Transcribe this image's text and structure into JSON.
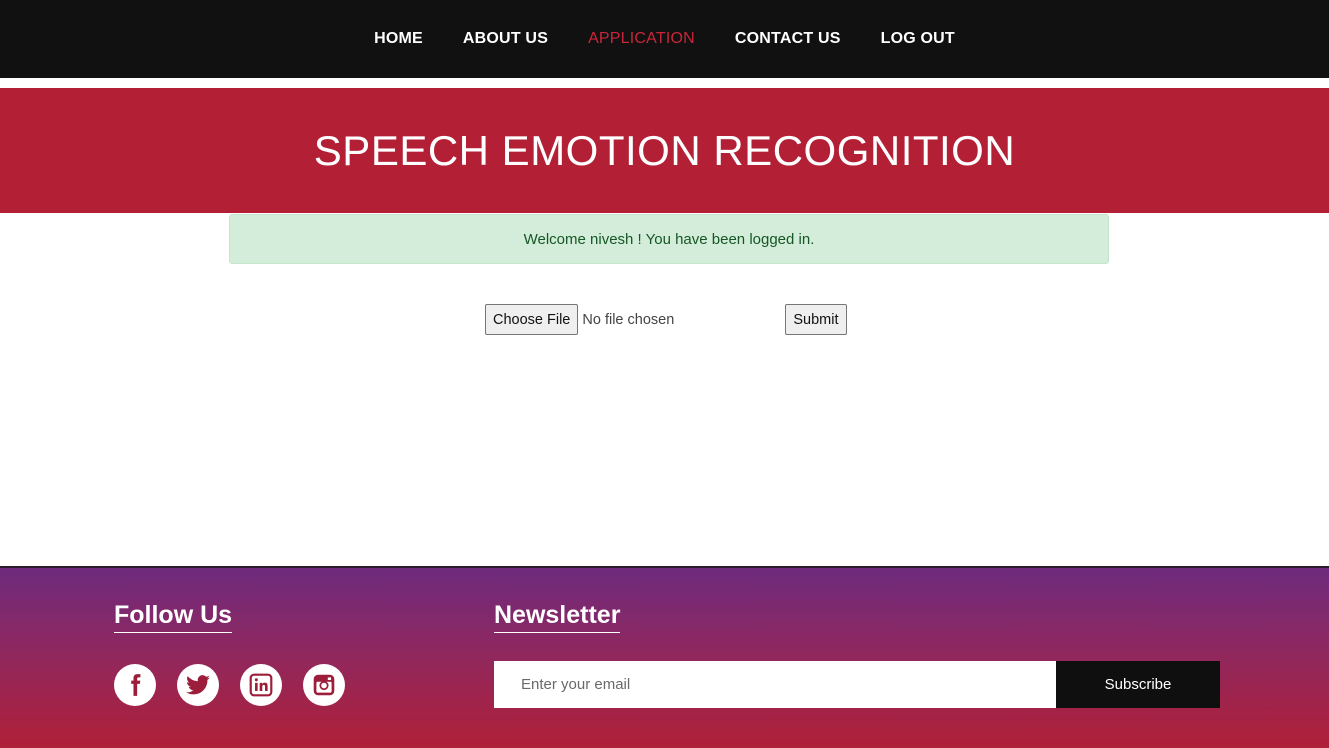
{
  "nav": {
    "items": [
      {
        "label": "HOME",
        "active": false
      },
      {
        "label": "ABOUT US",
        "active": false
      },
      {
        "label": "APPLICATION",
        "active": true
      },
      {
        "label": "CONTACT US",
        "active": false
      },
      {
        "label": "LOG OUT",
        "active": false
      }
    ]
  },
  "hero": {
    "title": "SPEECH EMOTION RECOGNITION"
  },
  "alert": {
    "message": "Welcome nivesh ! You have been logged in."
  },
  "upload": {
    "choose_label": "Choose File",
    "status": "No file chosen",
    "submit_label": "Submit"
  },
  "footer": {
    "follow_title": "Follow Us",
    "socials": [
      "facebook-icon",
      "twitter-icon",
      "linkedin-icon",
      "instagram-icon"
    ],
    "newsletter_title": "Newsletter",
    "email_placeholder": "Enter your email",
    "subscribe_label": "Subscribe"
  },
  "colors": {
    "nav_bg": "#111111",
    "accent": "#b32036",
    "active_link": "#c8263a",
    "alert_bg": "#d4edda",
    "alert_text": "#155724",
    "footer_top": "#6e2a7d",
    "footer_bottom": "#b02038"
  }
}
